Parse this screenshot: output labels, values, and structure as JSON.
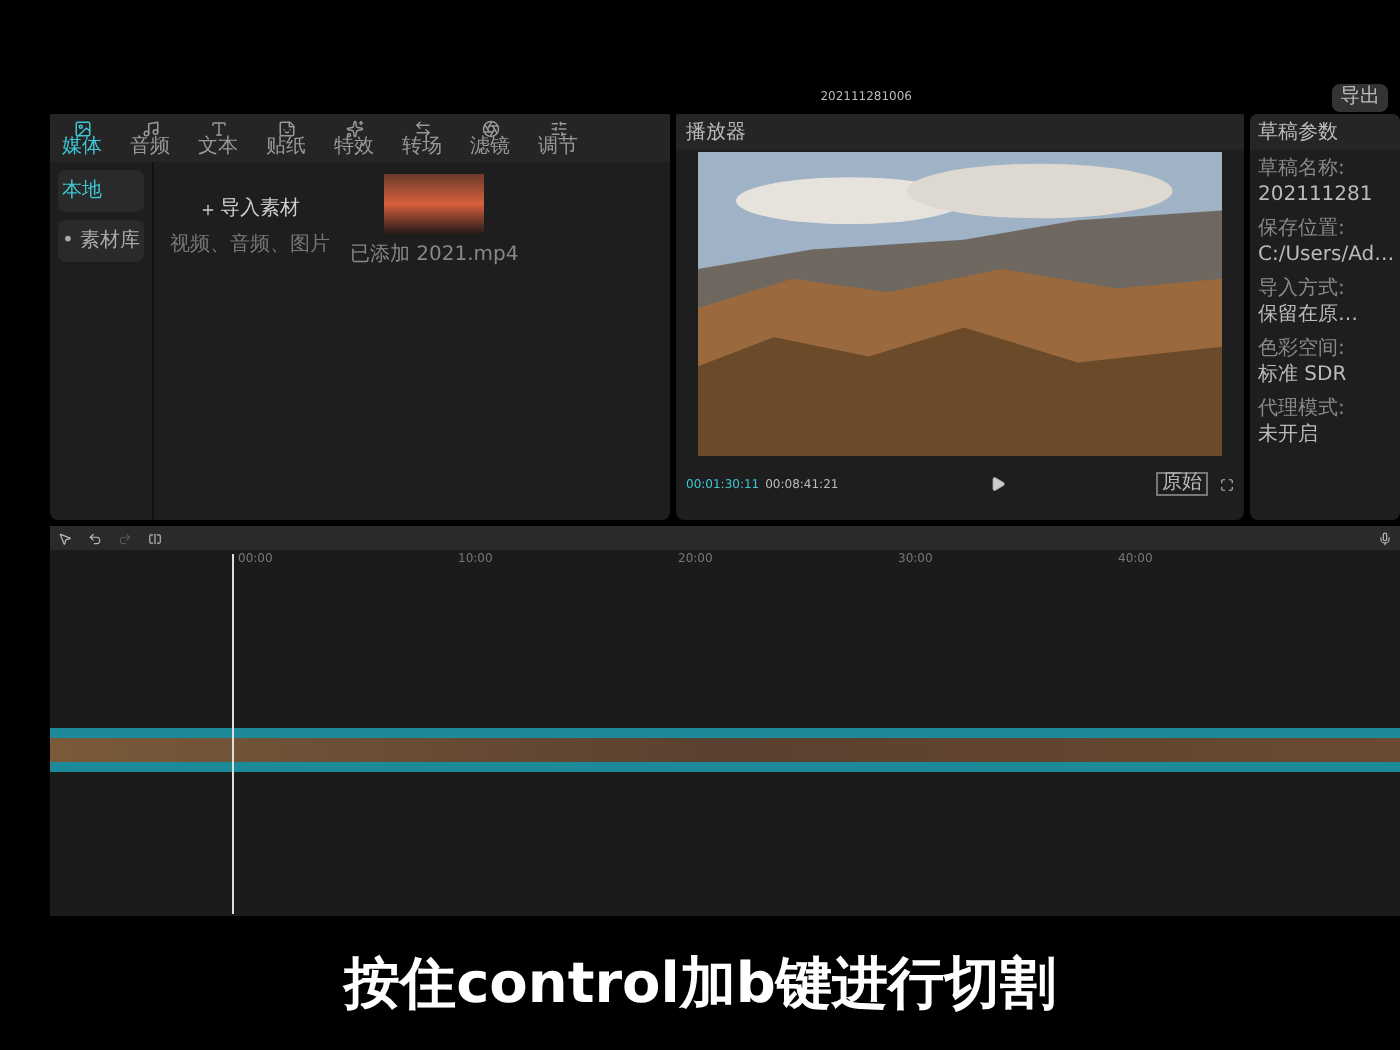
{
  "window": {
    "title": "202111281006",
    "export_button": "导出"
  },
  "media_tabs": [
    {
      "label": "媒体",
      "selected": true
    },
    {
      "label": "音频",
      "selected": false
    },
    {
      "label": "文本",
      "selected": false
    },
    {
      "label": "贴纸",
      "selected": false
    },
    {
      "label": "特效",
      "selected": false
    },
    {
      "label": "转场",
      "selected": false
    },
    {
      "label": "滤镜",
      "selected": false
    },
    {
      "label": "调节",
      "selected": false
    }
  ],
  "sidebar": {
    "items": [
      {
        "label": "本地",
        "selected": true
      },
      {
        "label": "• 素材库",
        "selected": false
      }
    ]
  },
  "import": {
    "label": "导入素材",
    "hint": "视频、音频、图片"
  },
  "media_items": [
    {
      "caption": "已添加 2021.mp4"
    }
  ],
  "player": {
    "title": "播放器",
    "current_time": "00:01:30:11",
    "total_time": "00:08:41:21",
    "ratio_button": "原始"
  },
  "draft_panel": {
    "title": "草稿参数",
    "rows": [
      {
        "label": "草稿名称:",
        "value": "202111281"
      },
      {
        "label": "保存位置:",
        "value": "C:/Users/Ad…"
      },
      {
        "label": "导入方式:",
        "value": "保留在原…"
      },
      {
        "label": "色彩空间:",
        "value": "标准 SDR"
      },
      {
        "label": "代理模式:",
        "value": "未开启"
      }
    ]
  },
  "timeline": {
    "ruler": [
      "00:00",
      "10:00",
      "20:00",
      "30:00",
      "40:00"
    ]
  },
  "subtitle": "按住control加b键进行切割"
}
